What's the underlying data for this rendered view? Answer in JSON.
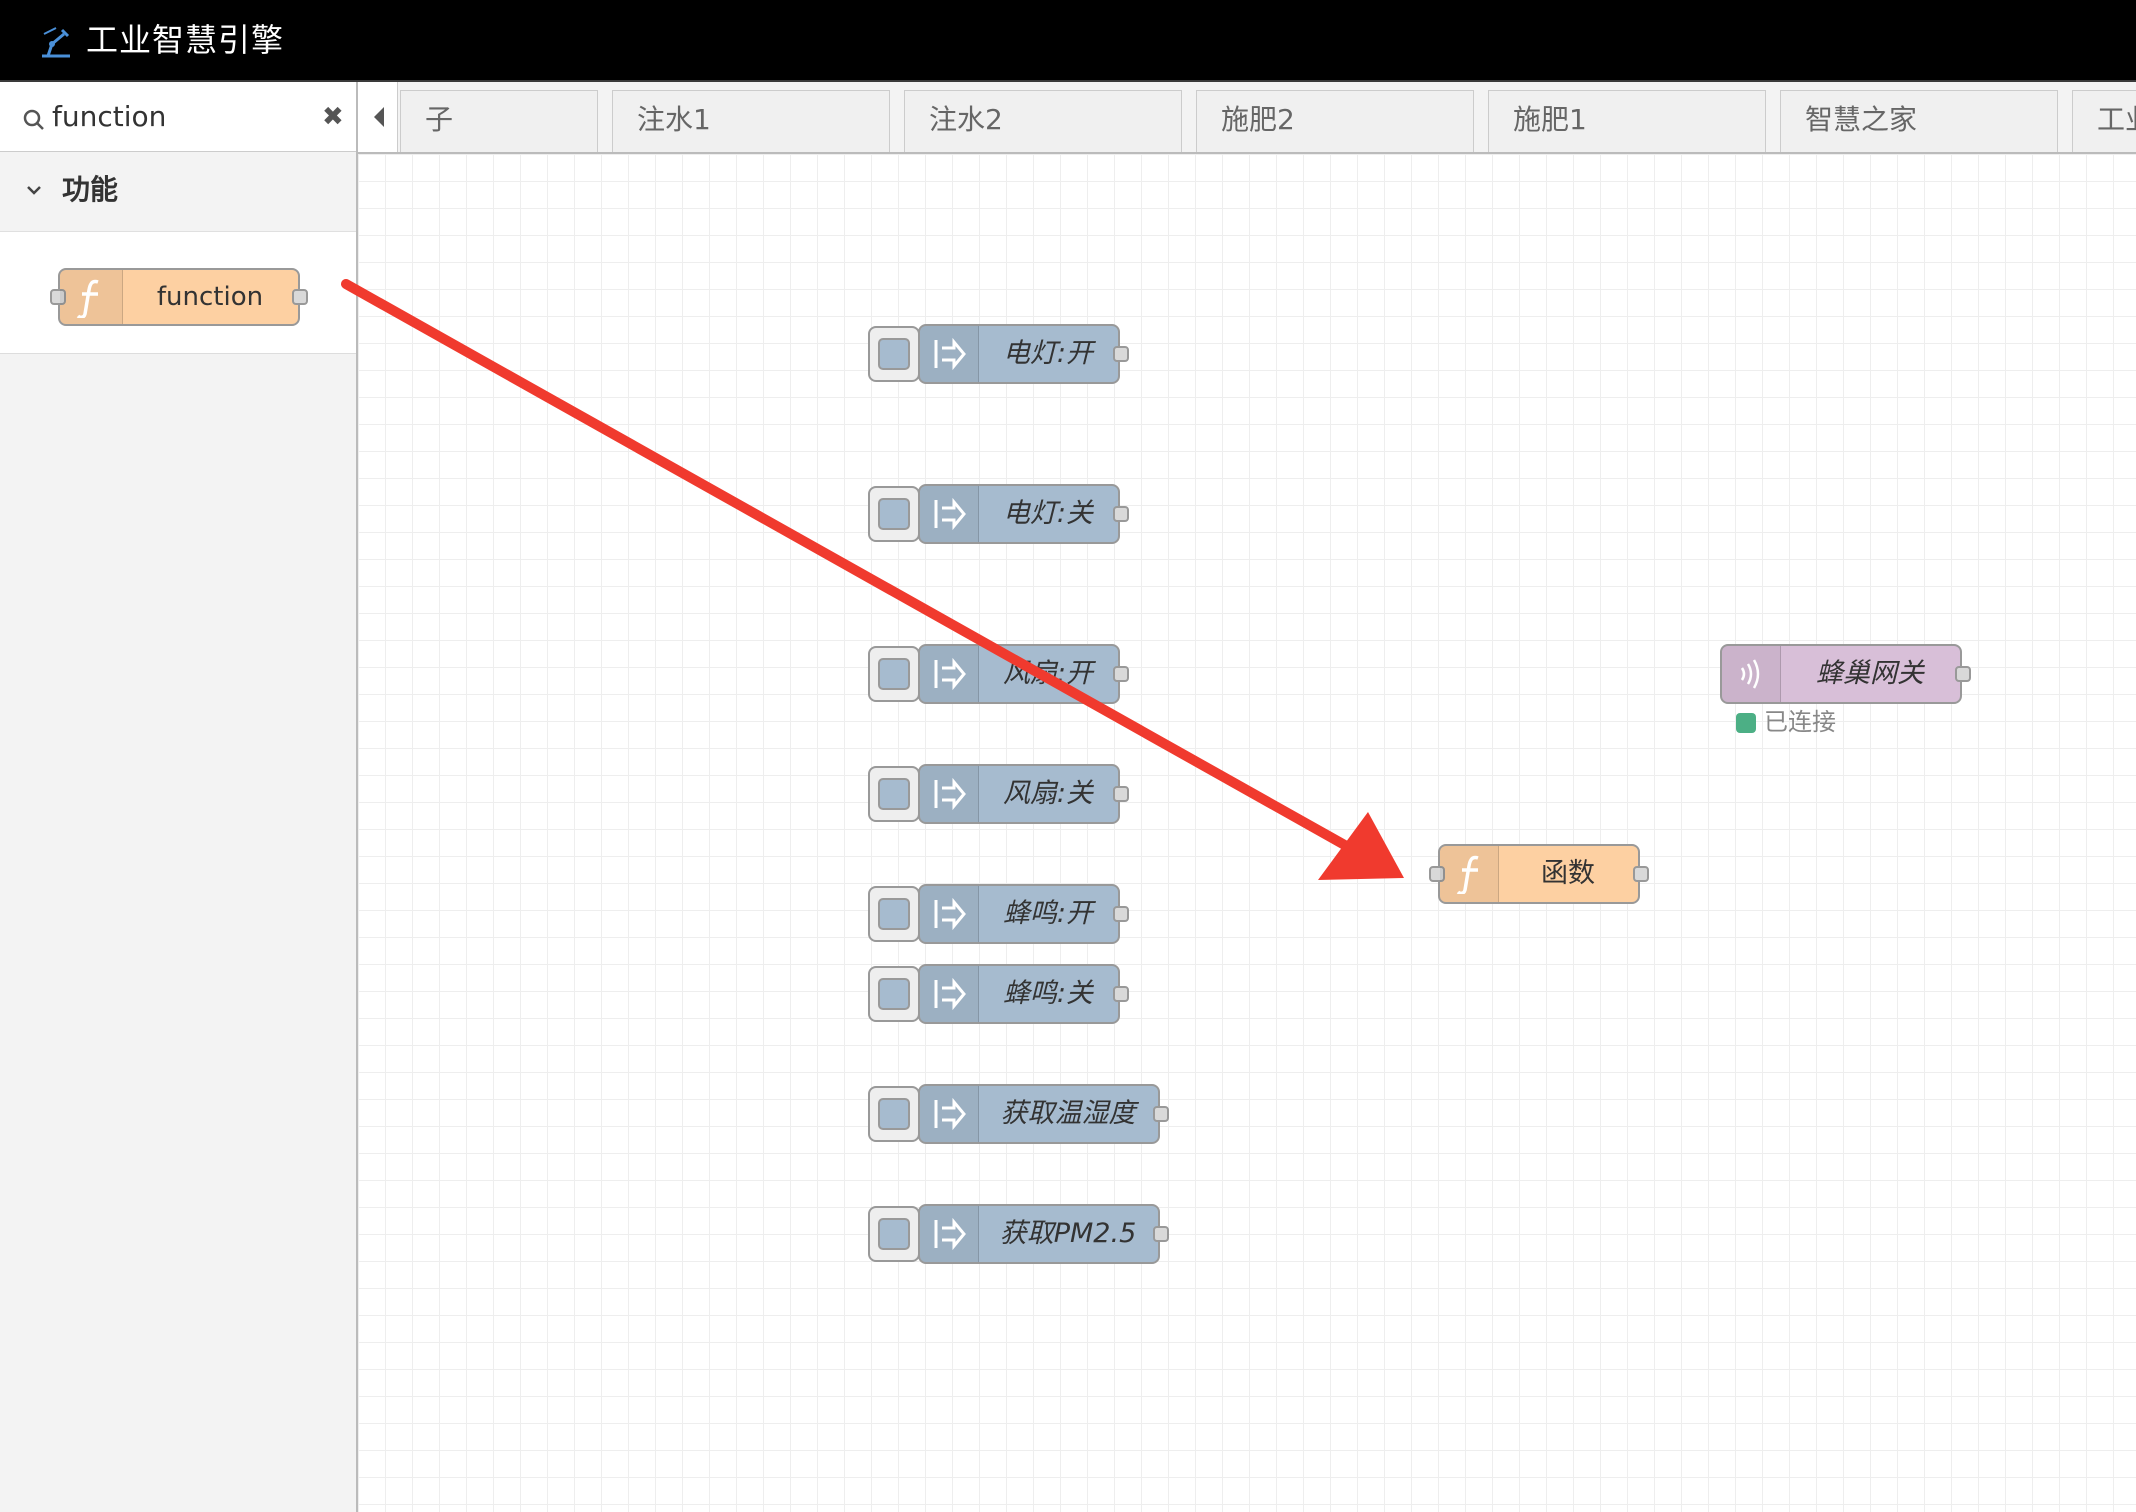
{
  "header": {
    "title": "工业智慧引擎",
    "logo_icon": "robot-arm-icon"
  },
  "palette": {
    "search": {
      "value": "function",
      "icon": "search-icon",
      "clear_icon": "close-icon"
    },
    "category": {
      "label": "功能",
      "expanded": true
    },
    "nodes": [
      {
        "label": "function",
        "icon": "function-icon",
        "color": "#fdd0a2"
      }
    ]
  },
  "tabs": [
    {
      "label": "子"
    },
    {
      "label": "注水1"
    },
    {
      "label": "注水2"
    },
    {
      "label": "施肥2"
    },
    {
      "label": "施肥1"
    },
    {
      "label": "智慧之家"
    },
    {
      "label": "工业"
    }
  ],
  "workspace": {
    "inject_nodes": [
      {
        "label": "电灯:开"
      },
      {
        "label": "电灯:关"
      },
      {
        "label": "风扇:开"
      },
      {
        "label": "风扇:关"
      },
      {
        "label": "蜂鸣:开"
      },
      {
        "label": "蜂鸣:关"
      },
      {
        "label": "获取温湿度"
      },
      {
        "label": "获取PM2.5"
      }
    ],
    "function_node": {
      "label": "函数",
      "icon": "function-icon"
    },
    "gateway_node": {
      "label": "蜂巢网关",
      "icon": "zigbee-signal-icon",
      "status": "已连接",
      "status_color": "#4caf85"
    }
  },
  "colors": {
    "inject": "#a6bbcf",
    "function": "#fdd0a2",
    "gateway": "#d8bfd8",
    "annotation_arrow": "#f03a2e"
  }
}
